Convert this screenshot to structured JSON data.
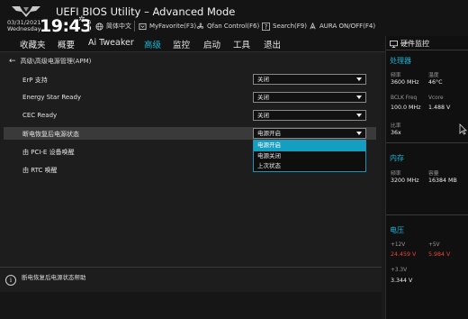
{
  "header": {
    "title": "UEFI BIOS Utility – Advanced Mode",
    "date": "03/31/2021",
    "weekday": "Wednesday",
    "time": "19:43",
    "buttons": [
      {
        "icon": "globe-icon",
        "label": "简体中文"
      },
      {
        "icon": "myfavorite-icon",
        "label": "MyFavorite(F3)"
      },
      {
        "icon": "fan-icon",
        "label": "Qfan Control(F6)"
      },
      {
        "icon": "question-icon",
        "label": "Search(F9)"
      },
      {
        "icon": "aura-icon",
        "label": "AURA ON/OFF(F4)"
      }
    ]
  },
  "nav": {
    "tabs": [
      "收藏夹",
      "概要",
      "Ai Tweaker",
      "高级",
      "监控",
      "启动",
      "工具",
      "退出"
    ],
    "active": "高级"
  },
  "main": {
    "breadcrumb": "高级\\高级电源管理(APM)",
    "rows": [
      {
        "label": "ErP 支持",
        "value": "关闭"
      },
      {
        "label": "Energy Star Ready",
        "value": "关闭"
      },
      {
        "label": "CEC Ready",
        "value": "关闭"
      },
      {
        "label": "断电恢复后电源状态",
        "value": "电源开启"
      },
      {
        "label": "由 PCI-E 设备唤醒",
        "value": ""
      },
      {
        "label": "由 RTC 唤醒",
        "value": ""
      }
    ],
    "dropdown_options": [
      "电源开启",
      "电源关闭",
      "上次状态"
    ],
    "dropdown_selected": "电源开启"
  },
  "help": {
    "icon": "info-icon",
    "text": "断电恢复后电源状态帮助"
  },
  "hardware_monitor": {
    "title": "硬件监控",
    "cpu": {
      "title": "处理器",
      "freq_label": "频率",
      "freq": "3600 MHz",
      "temp_label": "温度",
      "temp": "46°C",
      "bclk_label": "BCLK Freq",
      "bclk": "100.0 MHz",
      "vcore_label": "Vcore",
      "vcore": "1.488 V",
      "ratio_label": "比率",
      "ratio": "36x"
    },
    "memory": {
      "title": "内存",
      "freq_label": "频率",
      "freq": "3200 MHz",
      "cap_label": "容量",
      "cap": "16384 MB"
    },
    "voltage": {
      "title": "电压",
      "v12_label": "+12V",
      "v12": "24.459 V",
      "v5_label": "+5V",
      "v5": "5.984 V",
      "v33_label": "+3.3V",
      "v33": "3.344 V"
    }
  },
  "colors": {
    "accent": "#18b4d2",
    "warning": "#e8453c"
  }
}
